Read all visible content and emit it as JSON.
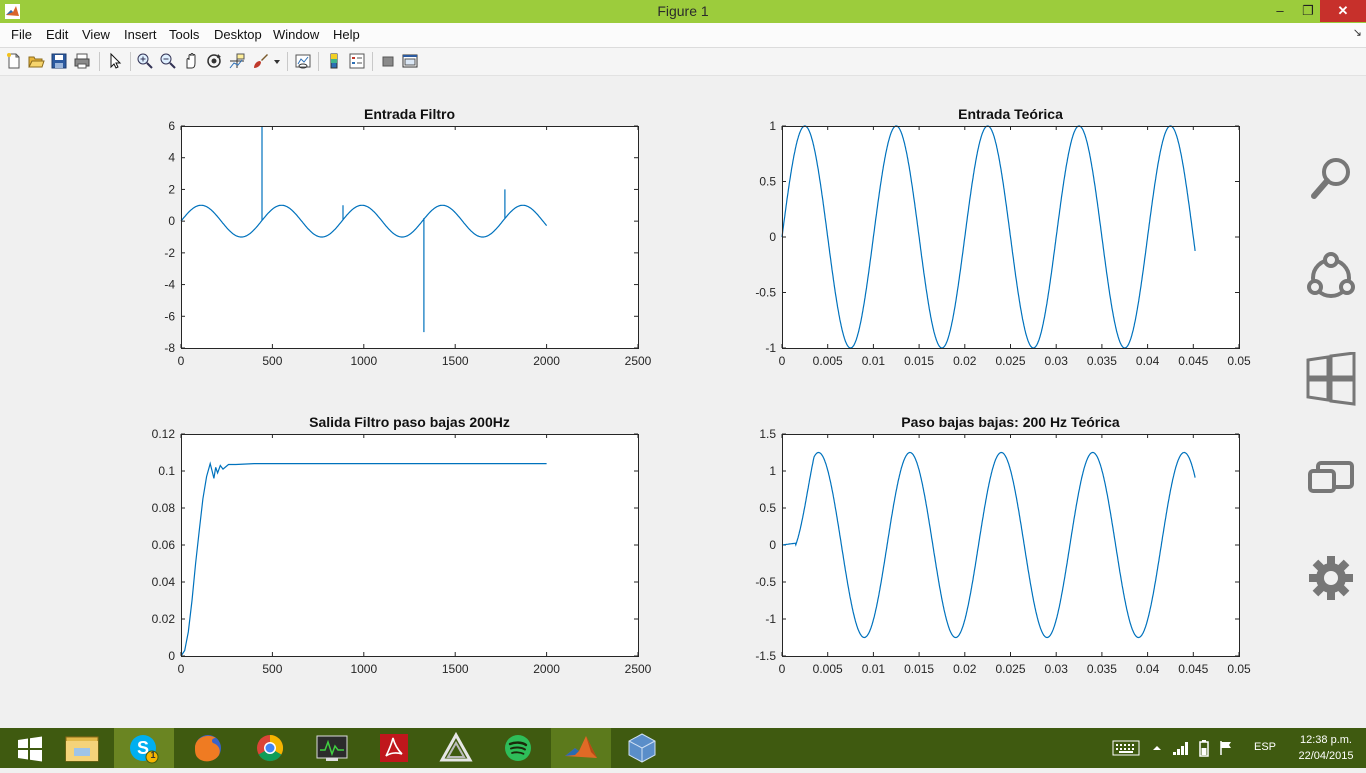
{
  "window": {
    "title": "Figure 1",
    "min_glyph": "–",
    "max_glyph": "❐",
    "close_glyph": "✕"
  },
  "menu": {
    "items": [
      "File",
      "Edit",
      "View",
      "Insert",
      "Tools",
      "Desktop",
      "Window",
      "Help"
    ],
    "dock_arrow": "↘"
  },
  "toolbar": {
    "icons": [
      "new-figure-icon",
      "open-file-icon",
      "save-icon",
      "print-icon",
      "pointer-icon",
      "zoom-in-icon",
      "zoom-out-icon",
      "pan-icon",
      "rotate-3d-icon",
      "data-cursor-icon",
      "brush-icon",
      "link-plot-icon",
      "colorbar-icon",
      "legend-icon",
      "hide-plot-tools-icon",
      "show-plot-tools-icon"
    ]
  },
  "chart_data": [
    {
      "type": "line",
      "title": "Entrada Filtro",
      "xlabel": "",
      "ylabel": "",
      "xlim": [
        0,
        2500
      ],
      "ylim": [
        -8,
        6
      ],
      "xticks": [
        0,
        500,
        1000,
        1500,
        2000,
        2500
      ],
      "xtick_labels": [
        "0",
        "500",
        "1000",
        "1500",
        "2000",
        "2500"
      ],
      "yticks": [
        -8,
        -6,
        -4,
        -2,
        0,
        2,
        4,
        6
      ],
      "ytick_labels": [
        "-8",
        "-6",
        "-4",
        "-2",
        "0",
        "2",
        "4",
        "6"
      ],
      "color": "#0072bd",
      "series": [
        {
          "signal": "sine",
          "amplitude": 1,
          "period": 440,
          "x_start": 0,
          "x_end": 2000,
          "spikes": [
            {
              "x": 443,
              "y": 6
            },
            {
              "x": 886,
              "y": 1
            },
            {
              "x": 1329,
              "y": -7
            },
            {
              "x": 1772,
              "y": 2
            }
          ]
        }
      ]
    },
    {
      "type": "line",
      "title": "Entrada Teórica",
      "xlabel": "",
      "ylabel": "",
      "xlim": [
        0,
        0.05
      ],
      "ylim": [
        -1,
        1
      ],
      "xticks": [
        0,
        0.005,
        0.01,
        0.015,
        0.02,
        0.025,
        0.03,
        0.035,
        0.04,
        0.045,
        0.05
      ],
      "xtick_labels": [
        "0",
        "0.005",
        "0.01",
        "0.015",
        "0.02",
        "0.025",
        "0.03",
        "0.035",
        "0.04",
        "0.045",
        "0.05"
      ],
      "yticks": [
        -1,
        -0.5,
        0,
        0.5,
        1
      ],
      "ytick_labels": [
        "-1",
        "-0.5",
        "0",
        "0.5",
        "1"
      ],
      "color": "#0072bd",
      "series": [
        {
          "signal": "sine",
          "amplitude": 1,
          "period": 0.01,
          "x_start": 0,
          "x_end": 0.0452
        }
      ]
    },
    {
      "type": "line",
      "title": "Salida Filtro paso bajas 200Hz",
      "xlabel": "",
      "ylabel": "",
      "xlim": [
        0,
        2500
      ],
      "ylim": [
        0,
        0.12
      ],
      "xticks": [
        0,
        500,
        1000,
        1500,
        2000,
        2500
      ],
      "xtick_labels": [
        "0",
        "500",
        "1000",
        "1500",
        "2000",
        "2500"
      ],
      "yticks": [
        0,
        0.02,
        0.04,
        0.06,
        0.08,
        0.1,
        0.12
      ],
      "ytick_labels": [
        "0",
        "0.02",
        "0.04",
        "0.06",
        "0.08",
        "0.1",
        "0.12"
      ],
      "color": "#0072bd",
      "series": [
        {
          "x": [
            0,
            20,
            40,
            60,
            80,
            100,
            120,
            140,
            160,
            170,
            180,
            190,
            200,
            215,
            230,
            260,
            300,
            400,
            800,
            1500,
            2000
          ],
          "y": [
            0,
            0.003,
            0.013,
            0.03,
            0.05,
            0.068,
            0.085,
            0.097,
            0.104,
            0.1,
            0.096,
            0.102,
            0.099,
            0.103,
            0.101,
            0.1035,
            0.1035,
            0.104,
            0.104,
            0.104,
            0.104
          ]
        }
      ]
    },
    {
      "type": "line",
      "title": "Paso bajas bajas: 200 Hz Teórica",
      "xlabel": "",
      "ylabel": "",
      "xlim": [
        0,
        0.05
      ],
      "ylim": [
        -1.5,
        1.5
      ],
      "xticks": [
        0,
        0.005,
        0.01,
        0.015,
        0.02,
        0.025,
        0.03,
        0.035,
        0.04,
        0.045,
        0.05
      ],
      "xtick_labels": [
        "0",
        "0.005",
        "0.01",
        "0.015",
        "0.02",
        "0.025",
        "0.03",
        "0.035",
        "0.04",
        "0.045",
        "0.05"
      ],
      "yticks": [
        -1.5,
        -1,
        -0.5,
        0,
        0.5,
        1,
        1.5
      ],
      "ytick_labels": [
        "-1.5",
        "-1",
        "-0.5",
        "0",
        "0.5",
        "1",
        "1.5"
      ],
      "color": "#0072bd",
      "series": [
        {
          "signal": "sine",
          "amplitude": 1.25,
          "period": 0.01,
          "phase_shift": 0.0015,
          "ramp": 0.0035,
          "x_start": 0,
          "x_end": 0.0452
        }
      ]
    }
  ],
  "charms": [
    "search-icon",
    "share-icon",
    "start-icon",
    "devices-icon",
    "settings-icon"
  ],
  "taskbar": {
    "apps": [
      "start-button",
      "file-explorer",
      "skype",
      "firefox",
      "chrome",
      "task-manager",
      "acrobat-reader",
      "unity",
      "spotify",
      "matlab",
      "virtualbox"
    ],
    "skype_badge": "1"
  },
  "tray": {
    "language": "ESP",
    "time": "12:38 p.m.",
    "date": "22/04/2015"
  }
}
